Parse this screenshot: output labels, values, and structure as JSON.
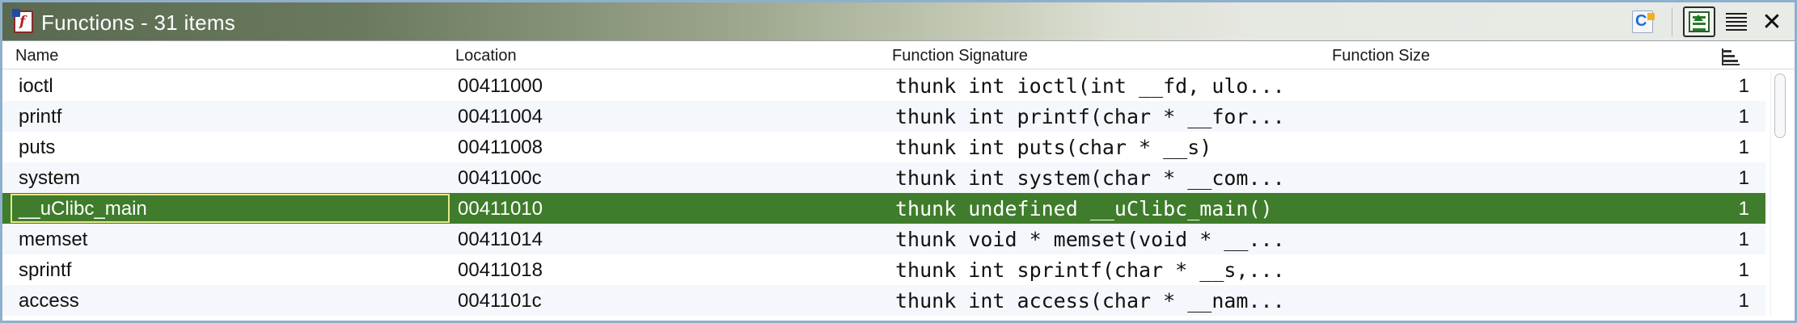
{
  "window": {
    "title": "Functions - 31 items",
    "icon": "function-table-icon"
  },
  "toolbar": {
    "buttons": [
      {
        "name": "copy-button",
        "icon": "copy-doc-icon"
      },
      {
        "name": "toggle-navigation-button",
        "icon": "navigate-selection-icon",
        "active": true
      },
      {
        "name": "view-list-button",
        "icon": "list-lines-icon"
      },
      {
        "name": "close-button",
        "icon": "close-icon",
        "glyph": "✕"
      }
    ]
  },
  "table": {
    "columns": {
      "name": "Name",
      "location": "Location",
      "signature": "Function Signature",
      "size": "Function Size"
    },
    "rows": [
      {
        "name": "ioctl",
        "location": "00411000",
        "signature": "thunk int ioctl(int __fd, ulo...",
        "size": "1",
        "selected": false
      },
      {
        "name": "printf",
        "location": "00411004",
        "signature": "thunk int printf(char * __for...",
        "size": "1",
        "selected": false
      },
      {
        "name": "puts",
        "location": "00411008",
        "signature": "thunk int puts(char * __s)",
        "size": "1",
        "selected": false
      },
      {
        "name": "system",
        "location": "0041100c",
        "signature": "thunk int system(char * __com...",
        "size": "1",
        "selected": false
      },
      {
        "name": "__uClibc_main",
        "location": "00411010",
        "signature": "thunk undefined __uClibc_main()",
        "size": "1",
        "selected": true
      },
      {
        "name": "memset",
        "location": "00411014",
        "signature": "thunk void * memset(void * __...",
        "size": "1",
        "selected": false
      },
      {
        "name": "sprintf",
        "location": "00411018",
        "signature": "thunk int sprintf(char * __s,...",
        "size": "1",
        "selected": false
      },
      {
        "name": "access",
        "location": "0041101c",
        "signature": "thunk int access(char * __nam...",
        "size": "1",
        "selected": false
      }
    ]
  },
  "colors": {
    "selection": "#3f7c2b",
    "title_gradient_start": "#5a6a50",
    "window_border": "#8eb0cc"
  }
}
